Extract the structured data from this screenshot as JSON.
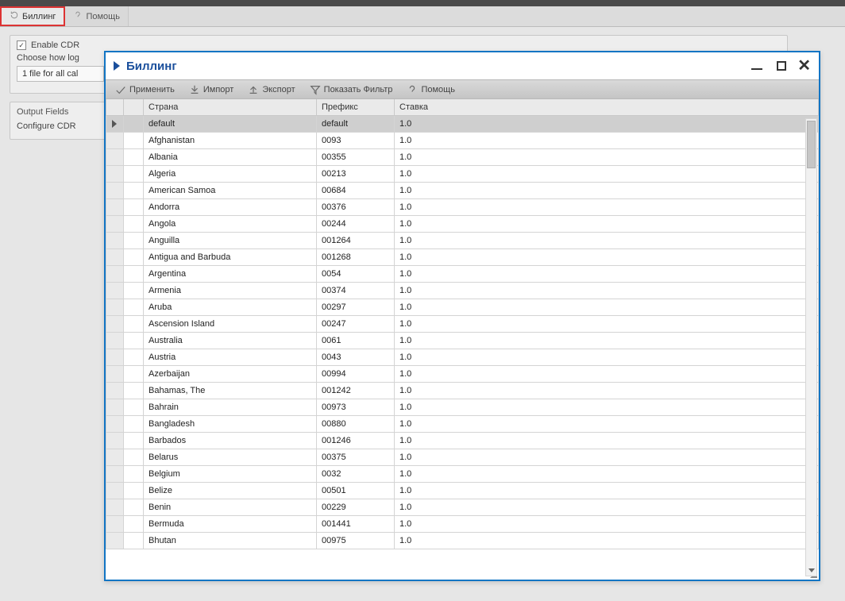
{
  "tabs": {
    "billing": "Биллинг",
    "help": "Помощь"
  },
  "bg": {
    "enable_cdr": "Enable CDR",
    "choose_how_log": "Choose how log",
    "file_for_all_cal": "1 file for all cal",
    "output_fields": "Output Fields",
    "configure_cdr": "Configure CDR "
  },
  "win": {
    "title": "Биллинг"
  },
  "toolbar": {
    "apply": "Применить",
    "import": "Импорт",
    "export": "Экспорт",
    "show_filter": "Показать Фильтр",
    "help": "Помощь"
  },
  "columns": {
    "country": "Страна",
    "prefix": "Префикс",
    "rate": "Ставка"
  },
  "rows": [
    {
      "country": "default",
      "prefix": "default",
      "rate": "1.0",
      "selected": true
    },
    {
      "country": "Afghanistan",
      "prefix": "0093",
      "rate": "1.0"
    },
    {
      "country": "Albania",
      "prefix": "00355",
      "rate": "1.0"
    },
    {
      "country": "Algeria",
      "prefix": "00213",
      "rate": "1.0"
    },
    {
      "country": "American Samoa",
      "prefix": "00684",
      "rate": "1.0"
    },
    {
      "country": "Andorra",
      "prefix": "00376",
      "rate": "1.0"
    },
    {
      "country": "Angola",
      "prefix": "00244",
      "rate": "1.0"
    },
    {
      "country": "Anguilla",
      "prefix": "001264",
      "rate": "1.0"
    },
    {
      "country": "Antigua and Barbuda",
      "prefix": "001268",
      "rate": "1.0"
    },
    {
      "country": "Argentina",
      "prefix": "0054",
      "rate": "1.0"
    },
    {
      "country": "Armenia",
      "prefix": "00374",
      "rate": "1.0"
    },
    {
      "country": "Aruba",
      "prefix": "00297",
      "rate": "1.0"
    },
    {
      "country": "Ascension Island",
      "prefix": "00247",
      "rate": "1.0"
    },
    {
      "country": "Australia",
      "prefix": "0061",
      "rate": "1.0"
    },
    {
      "country": "Austria",
      "prefix": "0043",
      "rate": "1.0"
    },
    {
      "country": "Azerbaijan",
      "prefix": "00994",
      "rate": "1.0"
    },
    {
      "country": "Bahamas, The",
      "prefix": "001242",
      "rate": "1.0"
    },
    {
      "country": "Bahrain",
      "prefix": "00973",
      "rate": "1.0"
    },
    {
      "country": "Bangladesh",
      "prefix": "00880",
      "rate": "1.0"
    },
    {
      "country": "Barbados",
      "prefix": "001246",
      "rate": "1.0"
    },
    {
      "country": "Belarus",
      "prefix": "00375",
      "rate": "1.0"
    },
    {
      "country": "Belgium",
      "prefix": "0032",
      "rate": "1.0"
    },
    {
      "country": "Belize",
      "prefix": "00501",
      "rate": "1.0"
    },
    {
      "country": "Benin",
      "prefix": "00229",
      "rate": "1.0"
    },
    {
      "country": "Bermuda",
      "prefix": "001441",
      "rate": "1.0"
    },
    {
      "country": "Bhutan",
      "prefix": "00975",
      "rate": "1.0"
    }
  ]
}
